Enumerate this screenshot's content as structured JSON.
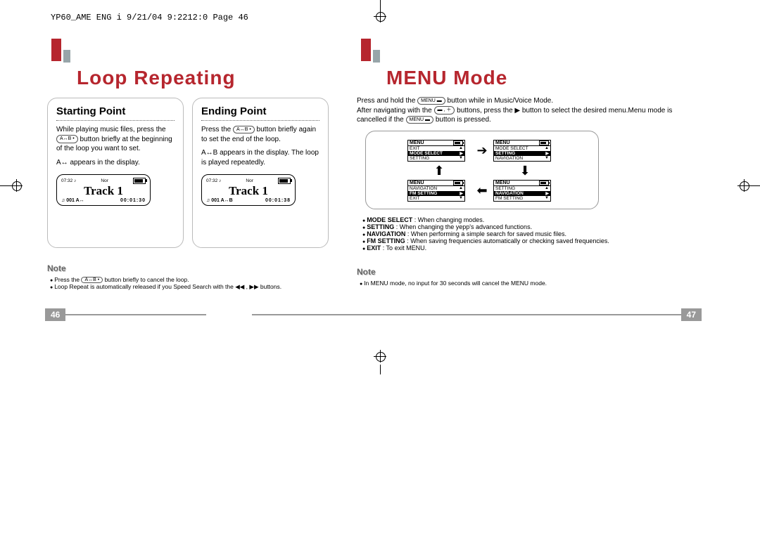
{
  "header_path": "YP60_AME ENG i  9/21/04 9:2212:0  Page 46",
  "left": {
    "title": "Loop Repeating",
    "starting": {
      "heading": "Starting Point",
      "para1a": "While playing music files, press the",
      "btn": "A↔B •",
      "para1b": "button briefly at the beginning of the loop you want to set.",
      "para2a": "A↔",
      "para2b": "appears in the display.",
      "lcd": {
        "top_time": "07:32",
        "nor": "Nor",
        "track": "Track 1",
        "bottom_left": "001",
        "icon": "A↔",
        "bottom_right": "00:01:30"
      }
    },
    "ending": {
      "heading": "Ending Point",
      "para1a": "Press the",
      "btn": "A↔B •",
      "para1b": "button briefly again to set the end of the loop.",
      "para2a": "A↔B",
      "para2b": "appears in the display. The loop is played repeatedly.",
      "lcd": {
        "top_time": "07:32",
        "nor": "Nor",
        "track": "Track 1",
        "bottom_left": "001",
        "icon": "A↔B",
        "bottom_right": "00:01:38"
      }
    },
    "note_heading": "Note",
    "notes": {
      "n1a": "Press the",
      "n1btn": "A↔B •",
      "n1b": "button briefly to cancel the loop.",
      "n2a": "Loop Repeat is automatically released if you Speed Search with the",
      "n2b": "◀◀ , ▶▶",
      "n2c": "buttons."
    },
    "pagenum": "46"
  },
  "right": {
    "title": "MENU Mode",
    "intro": {
      "l1a": "Press and hold the",
      "btn1": "MENU ▬",
      "l1b": "button while in Music/Voice Mode.",
      "l2a": "After navigating with the",
      "btn2": "▬ , ＋",
      "l2b": "buttons, press the ▶ button to select the desired menu.Menu mode is cancelled if the",
      "btn3": "MENU ▬",
      "l2c": "button is pressed."
    },
    "menus": {
      "a": {
        "title": "MENU",
        "rows": [
          "EXIT",
          "MODE SELECT",
          "SETTING"
        ],
        "hl": 1
      },
      "b": {
        "title": "MENU",
        "rows": [
          "MODE SELECT",
          "SETTING",
          "NAVIGATION"
        ],
        "hl": 1
      },
      "c": {
        "title": "MENU",
        "rows": [
          "NAVIGATION",
          "FM SETTING",
          "EXIT"
        ],
        "hl": 1
      },
      "d": {
        "title": "MENU",
        "rows": [
          "SETTING",
          "NAVIGATION",
          "FM SETTING"
        ],
        "hl": 1
      }
    },
    "desc": [
      {
        "term": "MODE SELECT",
        "text": ": When changing modes."
      },
      {
        "term": "SETTING",
        "text": ": When changing the yepp's advanced functions."
      },
      {
        "term": "NAVIGATION",
        "text": ": When performing a simple search for saved music files."
      },
      {
        "term": "FM SETTING",
        "text": ": When saving frequencies automatically or checking saved frequencies."
      },
      {
        "term": "EXIT",
        "text": ": To exit MENU."
      }
    ],
    "note_heading": "Note",
    "notes": {
      "n1": "In MENU mode, no input for 30 seconds will cancel the MENU mode."
    },
    "pagenum": "47"
  }
}
